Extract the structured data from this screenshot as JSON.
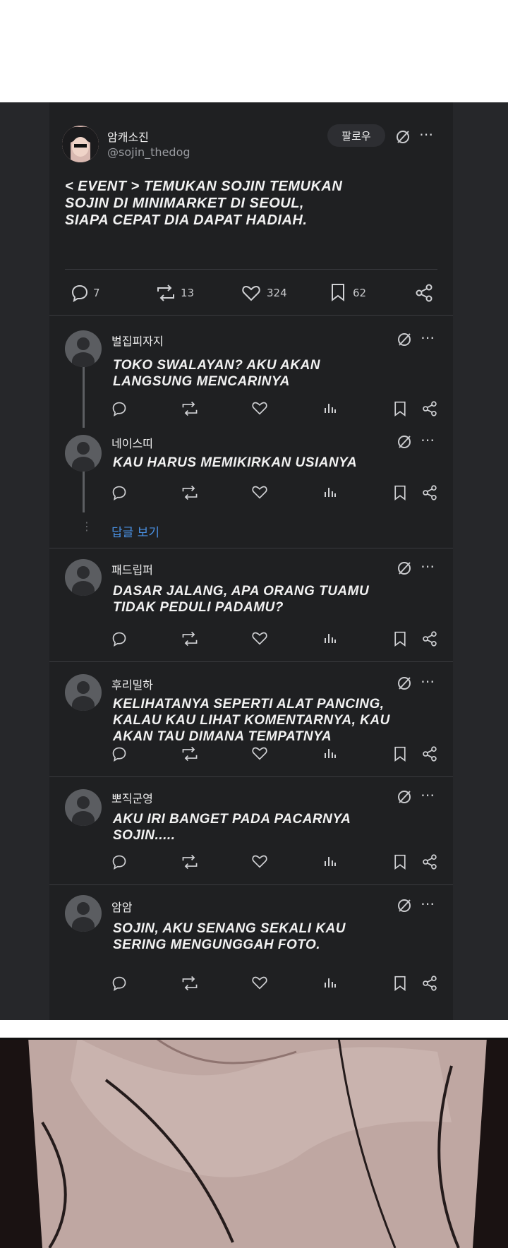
{
  "main_post": {
    "display_name": "암캐소진",
    "handle": "@sojin_thedog",
    "follow_label": "팔로우",
    "text_lines": [
      "< EVENT > TEMUKAN SOJIN TEMUKAN",
      "SOJIN DI MINIMARKET DI SEOUL,",
      "SIAPA CEPAT DIA DAPAT HADIAH."
    ],
    "replies_count": "7",
    "reposts_count": "13",
    "likes_count": "324",
    "bookmarks_count": "62"
  },
  "see_replies_label": "답글 보기",
  "replies": [
    {
      "name": "벌집피자지",
      "lines": [
        "TOKO SWALAYAN? AKU AKAN",
        "LANGSUNG MENCARINYA"
      ]
    },
    {
      "name": "네이스띠",
      "lines": [
        "KAU HARUS MEMIKIRKAN USIANYA"
      ]
    },
    {
      "name": "패드립퍼",
      "lines": [
        "DASAR JALANG, APA ORANG TUAMU",
        "TIDAK PEDULI PADAMU?"
      ]
    },
    {
      "name": "후리밀하",
      "lines": [
        "KELIHATANYA SEPERTI ALAT PANCING,",
        "KALAU KAU LIHAT KOMENTARNYA, KAU",
        "AKAN TAU DIMANA TEMPATNYA"
      ]
    },
    {
      "name": "뽀직군영",
      "lines": [
        "AKU IRI BANGET PADA PACARNYA",
        "SOJIN....."
      ]
    },
    {
      "name": "암암",
      "lines": [
        "SOJIN, AKU SENANG SEKALI KAU",
        "SERING MENGUNGGAH FOTO."
      ]
    }
  ],
  "colors": {
    "panel_bg": "#26272a",
    "card_bg": "#1f2022",
    "link": "#4a90e2"
  },
  "icons": [
    "reply-icon",
    "repost-icon",
    "like-icon",
    "bookmark-icon",
    "share-icon",
    "views-icon",
    "grok-icon",
    "more-icon"
  ]
}
